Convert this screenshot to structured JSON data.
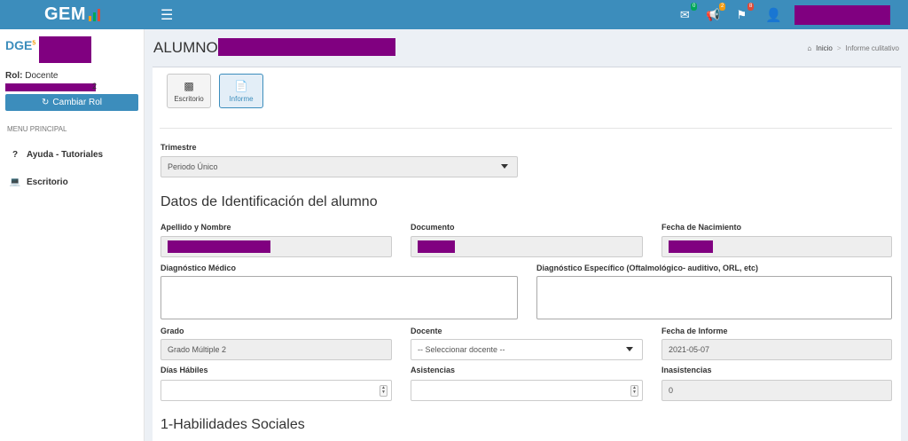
{
  "app": {
    "logo_text": "GEM",
    "brand": "DGE",
    "brand_sup": "5"
  },
  "topbar": {
    "menu_icon": "hamburger-icon",
    "notifications": [
      {
        "icon": "envelope-icon",
        "count": "0",
        "color": "#00a65a"
      },
      {
        "icon": "megaphone-icon",
        "count": "2",
        "color": "#f39c12"
      },
      {
        "icon": "flag-icon",
        "count": "8",
        "color": "#dd4b39"
      }
    ],
    "user_icon": "user-icon"
  },
  "sidebar": {
    "rol_label": "Rol:",
    "rol_value": "Docente",
    "school_suffix": "2",
    "cambiar_rol": "Cambiar Rol",
    "menu_header": "MENU PRINCIPAL",
    "items": [
      {
        "label": "Ayuda - Tutoriales",
        "icon": "question-icon"
      },
      {
        "label": "Escritorio",
        "icon": "laptop-icon"
      }
    ]
  },
  "header": {
    "title": "ALUMNO:",
    "breadcrumb": [
      {
        "label": "Inicio",
        "icon": "home-icon"
      },
      {
        "label": "Informe culitativo"
      }
    ]
  },
  "tabs": [
    {
      "label": "Escritorio",
      "icon": "id-card-icon"
    },
    {
      "label": "Informe",
      "icon": "document-icon"
    }
  ],
  "form": {
    "trimestre": {
      "label": "Trimestre",
      "value": "Periodo Único"
    },
    "section_identificacion": "Datos de Identificación del alumno",
    "apellido_nombre": {
      "label": "Apellido y Nombre"
    },
    "documento": {
      "label": "Documento"
    },
    "fecha_nacimiento": {
      "label": "Fecha de Nacimiento"
    },
    "diagnostico_medico": {
      "label": "Diagnóstico Médico"
    },
    "diagnostico_especifico": {
      "label": "Diagnóstico Específico (Oftalmológico- auditivo, ORL, etc)"
    },
    "grado": {
      "label": "Grado",
      "value": "Grado Múltiple 2"
    },
    "docente": {
      "label": "Docente",
      "placeholder": "-- Seleccionar docente --"
    },
    "fecha_informe": {
      "label": "Fecha de Informe",
      "value": "2021-05-07"
    },
    "dias_habiles": {
      "label": "Días Hábiles",
      "value": ""
    },
    "asistencias": {
      "label": "Asistencias",
      "value": ""
    },
    "inasistencias": {
      "label": "Inasistencias",
      "value": "0"
    },
    "section_habilidades": "1-Habilidades Sociales"
  }
}
